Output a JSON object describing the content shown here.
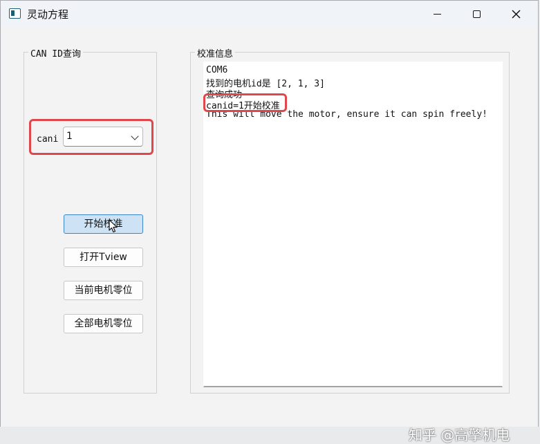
{
  "window": {
    "title": "灵动方程"
  },
  "left_group": {
    "title": "CAN ID查询",
    "cani_label": "cani",
    "combo_value": "1"
  },
  "buttons": {
    "start_calibration": "开始校准",
    "open_tview": "打开Tview",
    "current_motor_zero": "当前电机零位",
    "all_motors_zero": "全部电机零位"
  },
  "right_group": {
    "title": "校准信息",
    "log_lines": [
      "COM6",
      "找到的电机id是 [2, 1, 3]",
      "查询成功",
      "canid=1开始校准",
      "This will move the motor, ensure it can spin freely!"
    ]
  },
  "highlight_color": "#e0474c",
  "watermark": "知乎 @高擎机电",
  "icons": [
    "app-window-icon",
    "minimize-icon",
    "maximize-icon",
    "close-icon",
    "chevron-down-icon",
    "mouse-cursor-icon"
  ]
}
